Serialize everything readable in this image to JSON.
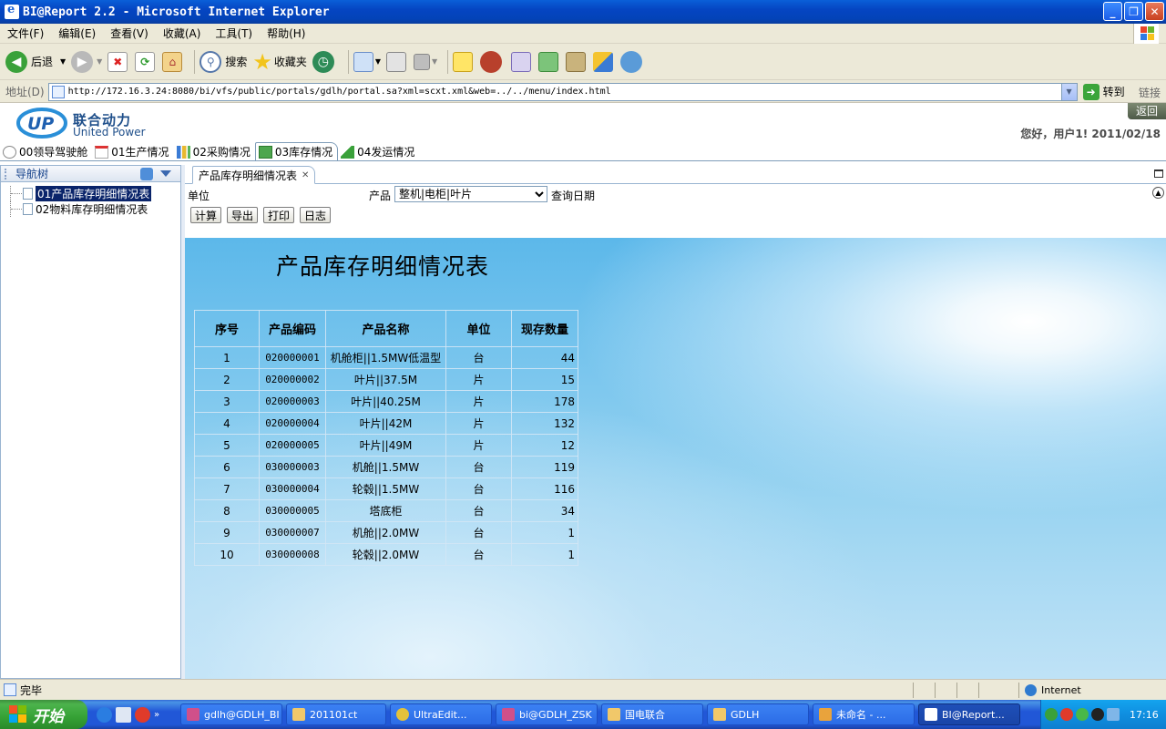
{
  "window": {
    "title": "BI@Report 2.2 - Microsoft Internet Explorer"
  },
  "menu": [
    "文件(F)",
    "编辑(E)",
    "查看(V)",
    "收藏(A)",
    "工具(T)",
    "帮助(H)"
  ],
  "toolbar": {
    "back": "后退",
    "search": "搜索",
    "favorites": "收藏夹"
  },
  "address": {
    "label": "地址(D)",
    "url": "http://172.16.3.24:8080/bi/vfs/public/portals/gdlh/portal.sa?xml=scxt.xml&web=../../menu/index.html",
    "go": "转到",
    "links": "链接"
  },
  "portal": {
    "logo_cn": "联合动力",
    "logo_en": "United Power",
    "back": "返回",
    "greeting": "您好，用户1! 2011/02/18",
    "tabs": [
      "00领导驾驶舱",
      "01生产情况",
      "02采购情况",
      "03库存情况",
      "04发运情况"
    ],
    "active_tab": 3
  },
  "sidebar": {
    "title": "导航树",
    "items": [
      "01产品库存明细情况表",
      "02物料库存明细情况表"
    ]
  },
  "report": {
    "tab_title": "产品库存明细情况表",
    "params": {
      "unit_label": "单位",
      "product_label": "产品",
      "product_value": "整机|电柜|叶片",
      "date_label": "查询日期"
    },
    "buttons": [
      "计算",
      "导出",
      "打印",
      "日志"
    ],
    "title": "产品库存明细情况表",
    "columns": [
      "序号",
      "产品编码",
      "产品名称",
      "单位",
      "现存数量"
    ],
    "rows": [
      [
        "1",
        "020000001",
        "机舱柜||1.5MW低温型",
        "台",
        "44"
      ],
      [
        "2",
        "020000002",
        "叶片||37.5M",
        "片",
        "15"
      ],
      [
        "3",
        "020000003",
        "叶片||40.25M",
        "片",
        "178"
      ],
      [
        "4",
        "020000004",
        "叶片||42M",
        "片",
        "132"
      ],
      [
        "5",
        "020000005",
        "叶片||49M",
        "片",
        "12"
      ],
      [
        "6",
        "030000003",
        "机舱||1.5MW",
        "台",
        "119"
      ],
      [
        "7",
        "030000004",
        "轮毂||1.5MW",
        "台",
        "116"
      ],
      [
        "8",
        "030000005",
        "塔底柜",
        "台",
        "34"
      ],
      [
        "9",
        "030000007",
        "机舱||2.0MW",
        "台",
        "1"
      ],
      [
        "10",
        "030000008",
        "轮毂||2.0MW",
        "台",
        "1"
      ]
    ]
  },
  "status": {
    "text": "完毕",
    "zone": "Internet"
  },
  "taskbar": {
    "start": "开始",
    "tasks": [
      "gdlh@GDLH_BI",
      "201101ct",
      "UltraEdit...",
      "bi@GDLH_ZSK",
      "国电联合",
      "GDLH",
      "未命名 - ...",
      "BI@Report..."
    ],
    "clock": "17:16"
  },
  "colors": {
    "title_bar": "#0545c2",
    "selected_tree_item": "#0a246a",
    "taskbar": "#2157d7",
    "start_button": "#35a135"
  }
}
